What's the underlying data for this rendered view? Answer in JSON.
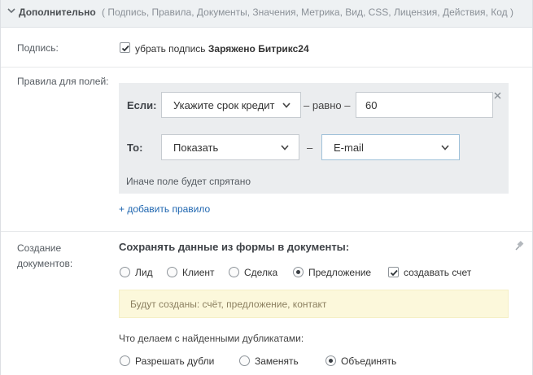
{
  "header": {
    "title": "Дополнительно",
    "subtitle": "( Подпись, Правила, Документы, Значения, Метрика, Вид, CSS, Лицензия, Действия, Код )"
  },
  "signature": {
    "label": "Подпись:",
    "checkbox_text": "убрать подпись",
    "checkbox_brand": "Заряжено Битрикс24",
    "checked": true
  },
  "rules": {
    "label": "Правила для полей:",
    "if_label": "Если:",
    "if_field": "Укажите срок кредит",
    "equals_text": "– равно –",
    "value": "60",
    "then_label": "То:",
    "action": "Показать",
    "dash": "–",
    "target_field": "E-mail",
    "otherwise_text": "Иначе поле будет спрятано",
    "add_rule_link": "+ добавить правило"
  },
  "documents": {
    "label_line1": "Создание",
    "label_line2": "документов:",
    "heading": "Сохранять данные из формы в документы:",
    "options": [
      "Лид",
      "Клиент",
      "Сделка",
      "Предложение"
    ],
    "selected": "Предложение",
    "create_invoice": "создавать счет",
    "invoice_checked": true,
    "notice": "Будут созданы: счёт, предложение, контакт",
    "duplicates_question": "Что делаем с найденными дубликатами:",
    "duplicate_options": [
      "Разрешать дубли",
      "Заменять",
      "Объединять"
    ],
    "duplicate_selected": "Объединять"
  },
  "colors": {
    "accent_link": "#2067b0",
    "notice_bg": "#fcf8db",
    "rules_bg": "#ebedef"
  }
}
